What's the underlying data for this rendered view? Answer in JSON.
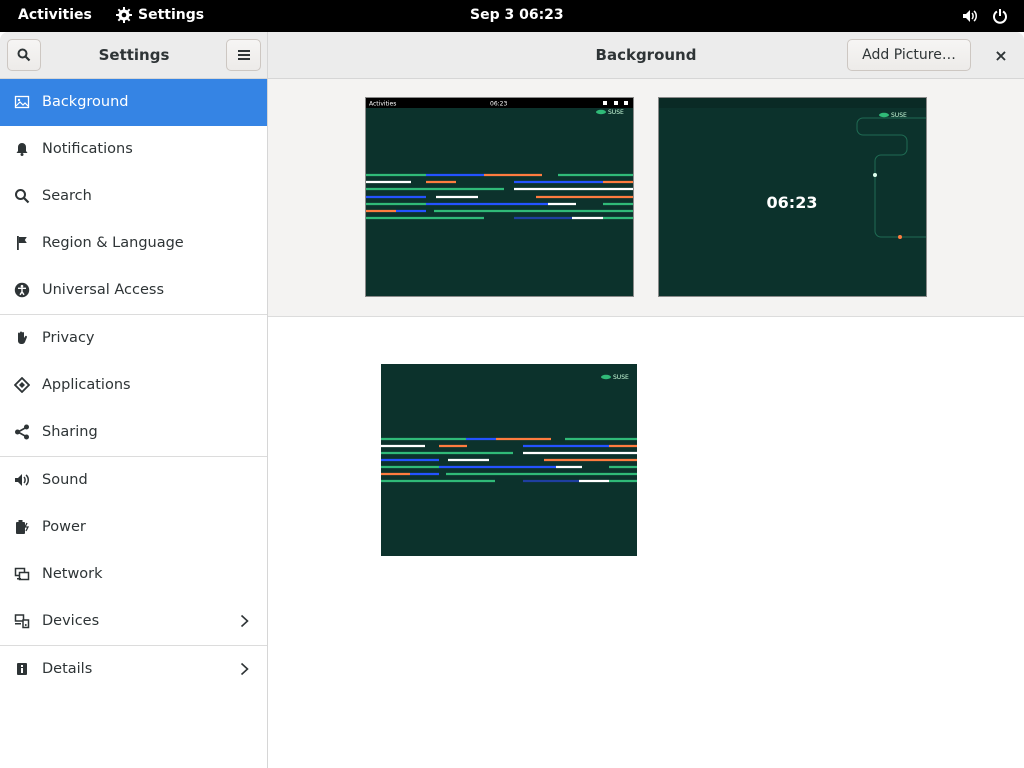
{
  "topbar": {
    "activities": "Activities",
    "app_name": "Settings",
    "clock": "Sep 3  06:23"
  },
  "header": {
    "sidebar_title": "Settings",
    "main_title": "Background",
    "add_picture": "Add Picture…",
    "close": "×"
  },
  "sidebar": {
    "items": [
      {
        "label": "Background",
        "icon": "background-icon"
      },
      {
        "label": "Notifications",
        "icon": "bell-icon"
      },
      {
        "label": "Search",
        "icon": "search-icon"
      },
      {
        "label": "Region & Language",
        "icon": "flag-icon"
      },
      {
        "label": "Universal Access",
        "icon": "accessibility-icon"
      },
      {
        "label": "Privacy",
        "icon": "hand-icon"
      },
      {
        "label": "Applications",
        "icon": "applications-icon"
      },
      {
        "label": "Sharing",
        "icon": "share-icon"
      },
      {
        "label": "Sound",
        "icon": "speaker-icon"
      },
      {
        "label": "Power",
        "icon": "power-icon"
      },
      {
        "label": "Network",
        "icon": "network-icon"
      },
      {
        "label": "Devices",
        "icon": "devices-icon"
      },
      {
        "label": "Details",
        "icon": "info-icon"
      }
    ]
  },
  "previews": {
    "desktop": {
      "activities": "Activities",
      "clock": "06:23",
      "brand": "SUSE"
    },
    "lock": {
      "clock": "06:23",
      "brand": "SUSE"
    }
  },
  "gallery": {
    "brand": "SUSE"
  },
  "colors": {
    "accent": "#3584e4",
    "wallpaper": "#0c322c",
    "green": "#30ba78",
    "orange": "#fe7c3f",
    "blue": "#2453ff"
  }
}
